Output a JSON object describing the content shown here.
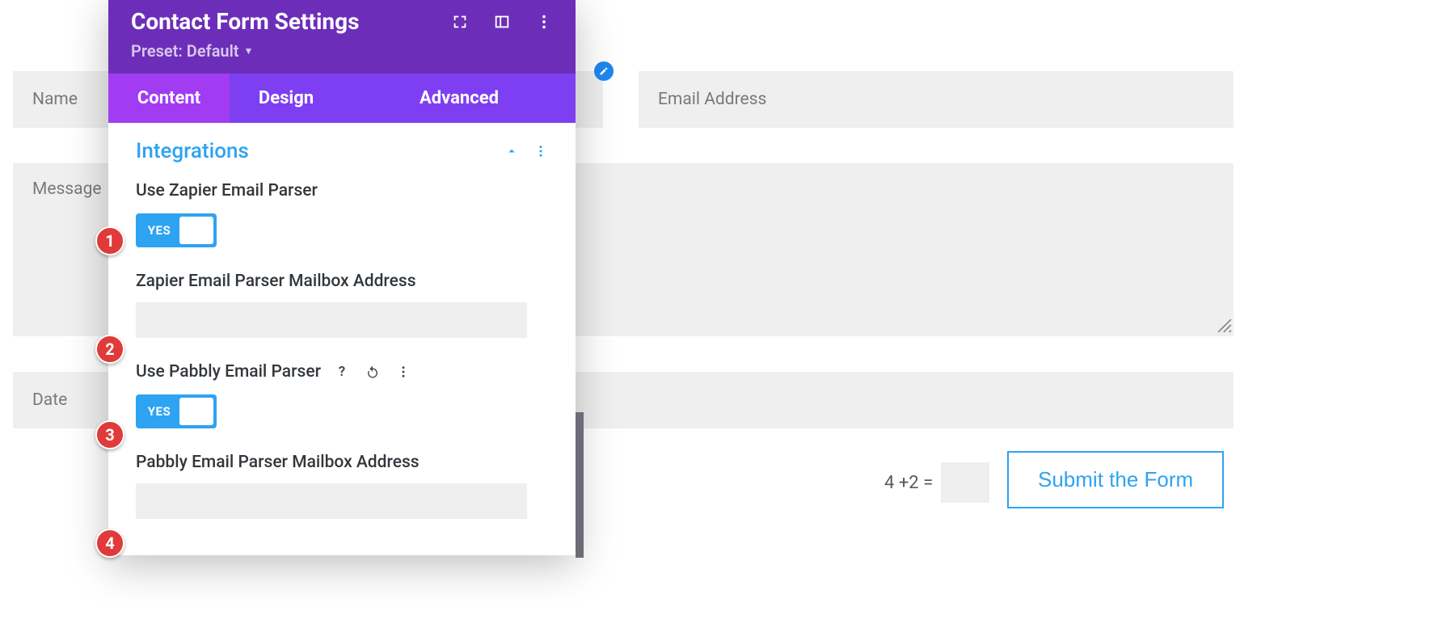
{
  "form": {
    "name_placeholder": "Name",
    "email_placeholder": "Email Address",
    "message_placeholder": "Message",
    "date_placeholder": "Date",
    "captcha_prompt": "4 +2 =",
    "submit_label": "Submit the Form"
  },
  "modal": {
    "title": "Contact Form Settings",
    "preset_label": "Preset: Default",
    "tabs": {
      "content": "Content",
      "design": "Design",
      "advanced": "Advanced"
    },
    "section_title": "Integrations",
    "settings": {
      "zapier_toggle_label": "Use Zapier Email Parser",
      "zapier_toggle_value": "YES",
      "zapier_address_label": "Zapier Email Parser Mailbox Address",
      "pabbly_toggle_label": "Use Pabbly Email Parser",
      "pabbly_toggle_value": "YES",
      "pabbly_address_label": "Pabbly Email Parser Mailbox Address"
    }
  },
  "annotations": {
    "b1": "1",
    "b2": "2",
    "b3": "3",
    "b4": "4"
  }
}
